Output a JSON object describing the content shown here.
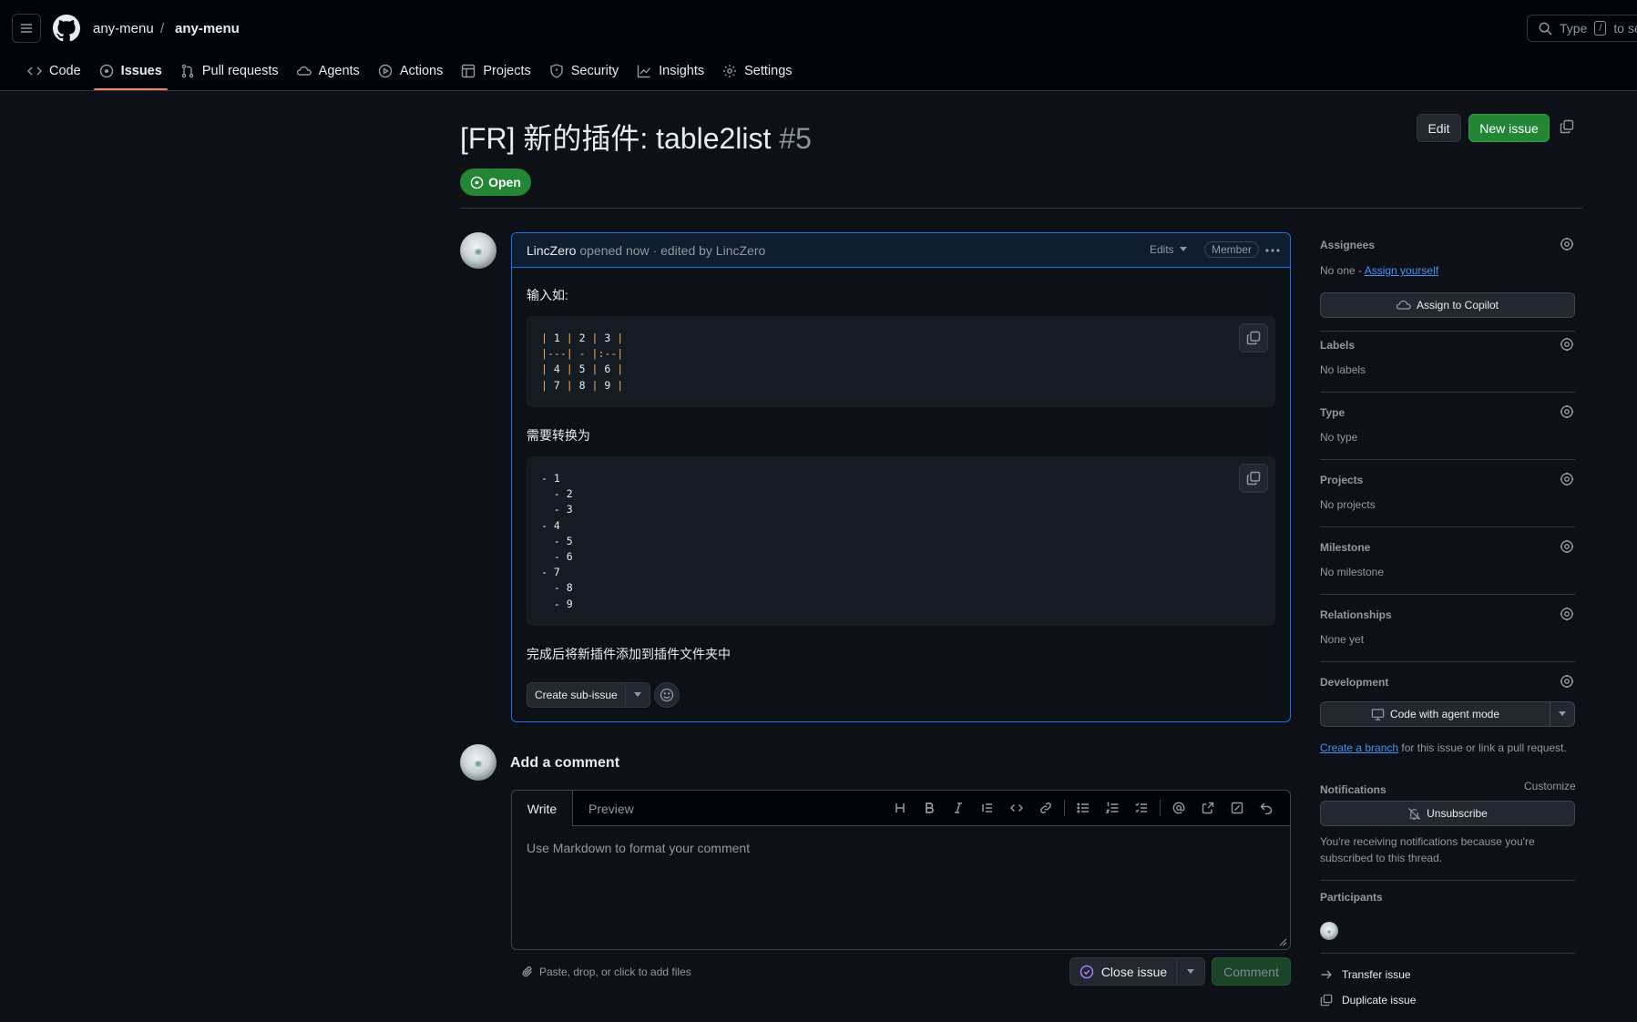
{
  "header": {
    "owner": "any-menu",
    "separator": "/",
    "repo": "any-menu",
    "search_placeholder_pre": "Type",
    "search_key": "/",
    "search_placeholder_post": "to se"
  },
  "tabs": [
    {
      "label": "Code",
      "icon": "code-icon"
    },
    {
      "label": "Issues",
      "icon": "issue-opened-icon",
      "active": true
    },
    {
      "label": "Pull requests",
      "icon": "git-pull-request-icon"
    },
    {
      "label": "Agents",
      "icon": "agent-icon"
    },
    {
      "label": "Actions",
      "icon": "play-icon"
    },
    {
      "label": "Projects",
      "icon": "table-icon"
    },
    {
      "label": "Security",
      "icon": "shield-icon"
    },
    {
      "label": "Insights",
      "icon": "graph-icon"
    },
    {
      "label": "Settings",
      "icon": "gear-icon"
    }
  ],
  "issue": {
    "title": "[FR] 新的插件: table2list",
    "number": "#5",
    "state": "Open",
    "edit_label": "Edit",
    "new_issue_label": "New issue"
  },
  "comment": {
    "author": "LincZero",
    "meta": "opened now · edited by LincZero",
    "edits_label": "Edits",
    "role_badge": "Member",
    "para1": "输入如:",
    "code1": "| 1 | 2 | 3 |\n|---| - |:--|\n| 4 | 5 | 6 |\n| 7 | 8 | 9 |",
    "para2": "需要转换为",
    "code2": "- 1\n  - 2\n  - 3\n- 4\n  - 5\n  - 6\n- 7\n  - 8\n  - 9",
    "para3": "完成后将新插件添加到插件文件夹中",
    "sub_issue_label": "Create sub-issue"
  },
  "composer": {
    "heading": "Add a comment",
    "write_tab": "Write",
    "preview_tab": "Preview",
    "placeholder": "Use Markdown to format your comment",
    "attach_hint": "Paste, drop, or click to add files",
    "close_label": "Close issue",
    "comment_label": "Comment"
  },
  "sidebar": {
    "assignees": {
      "heading": "Assignees",
      "value_prefix": "No one - ",
      "assign_link": "Assign yourself",
      "copilot_button": "Assign to Copilot"
    },
    "labels": {
      "heading": "Labels",
      "value": "No labels"
    },
    "type": {
      "heading": "Type",
      "value": "No type"
    },
    "projects": {
      "heading": "Projects",
      "value": "No projects"
    },
    "milestone": {
      "heading": "Milestone",
      "value": "No milestone"
    },
    "relationships": {
      "heading": "Relationships",
      "value": "None yet"
    },
    "development": {
      "heading": "Development",
      "button": "Code with agent mode",
      "link": "Create a branch",
      "suffix": " for this issue or link a pull request."
    },
    "notifications": {
      "heading": "Notifications",
      "customize": "Customize",
      "button": "Unsubscribe",
      "note_line1": "You're receiving notifications because you're",
      "note_line2": "subscribed to this thread."
    },
    "participants": {
      "heading": "Participants"
    },
    "actions": {
      "transfer": "Transfer issue",
      "duplicate": "Duplicate issue"
    }
  },
  "colors": {
    "accent_green": "#238636",
    "tab_underline": "#f78166",
    "link": "#4493f8",
    "focus_border": "#1f6feb"
  }
}
